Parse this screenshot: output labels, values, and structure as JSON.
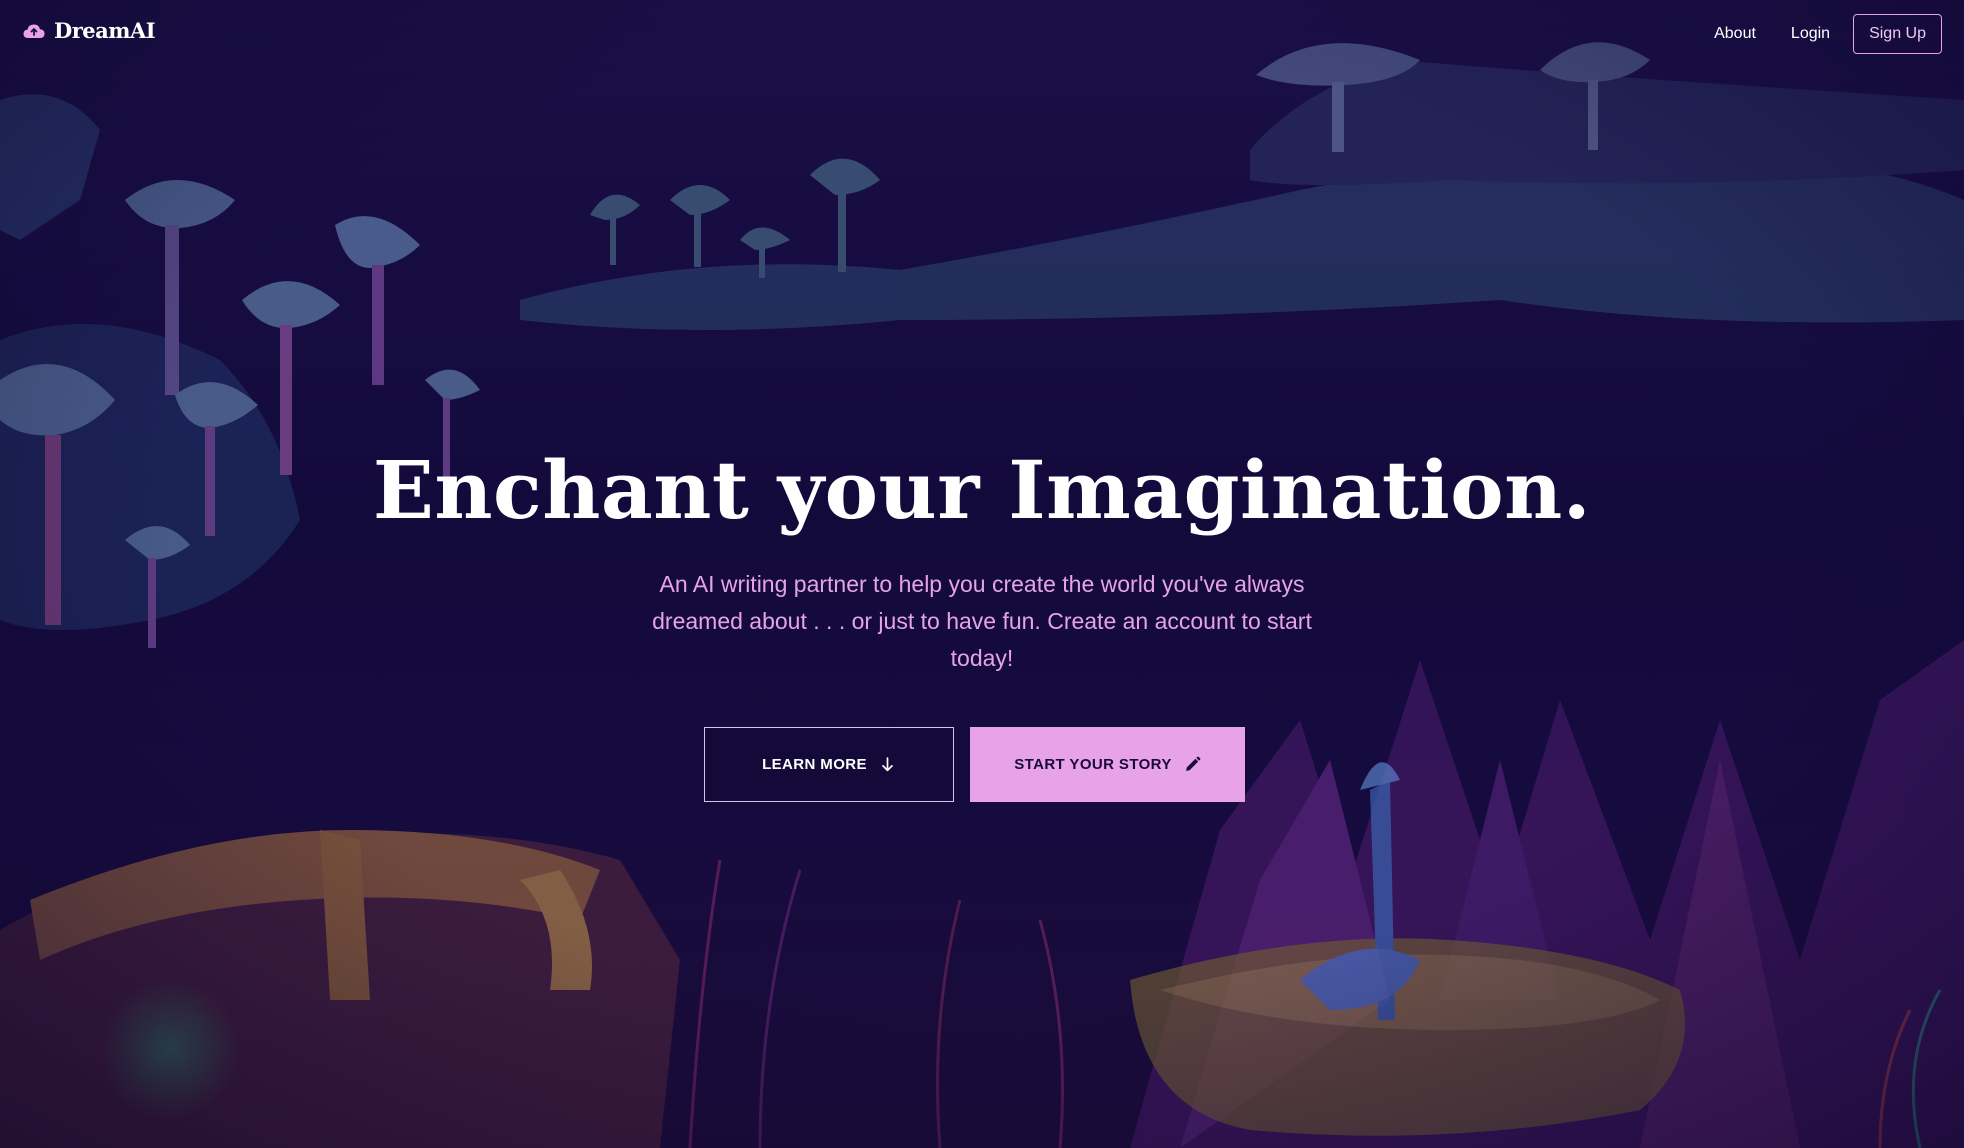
{
  "brand": {
    "name": "DreamAI",
    "icon": "cloud-icon"
  },
  "nav": {
    "about": "About",
    "login": "Login",
    "signup": "Sign Up"
  },
  "hero": {
    "headline": "Enchant your Imagination.",
    "subtitle": "An AI writing partner to help you create the world you've always dreamed about . . . or just to have fun. Create an account to start today!",
    "learn_more": "LEARN MORE",
    "learn_more_icon": "arrow-down-icon",
    "start_story": "START YOUR STORY",
    "start_story_icon": "pencil-icon",
    "background": "fantasy forest illustration with glowing mushrooms"
  },
  "colors": {
    "background": "#12093a",
    "accent": "#e7a2e8",
    "subtitle": "#e6a4e6",
    "text": "#ffffff"
  }
}
